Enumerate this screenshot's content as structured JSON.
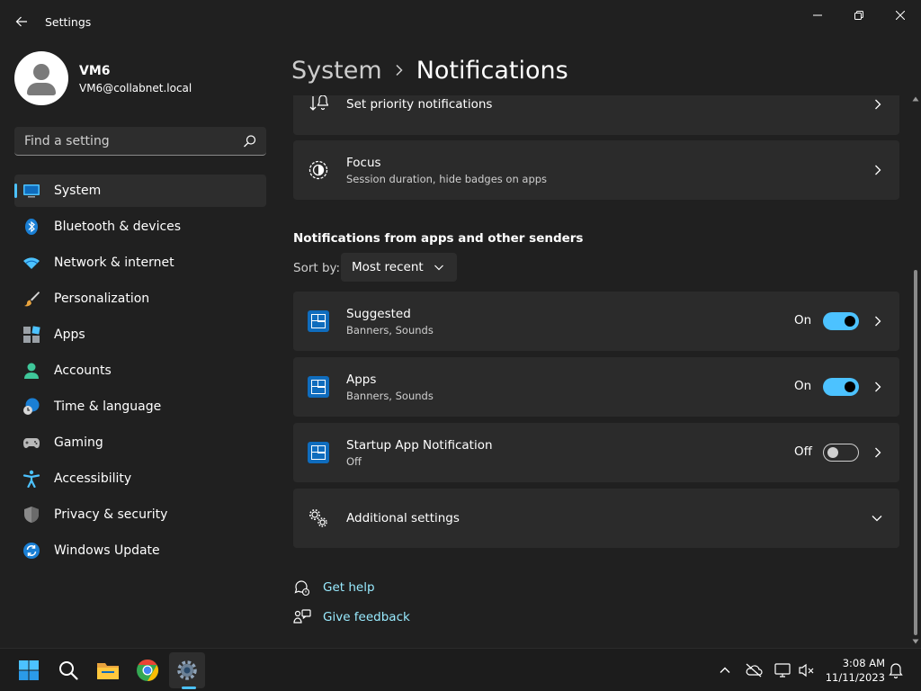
{
  "window": {
    "title": "Settings"
  },
  "profile": {
    "name": "VM6",
    "email": "VM6@collabnet.local"
  },
  "search": {
    "placeholder": "Find a setting"
  },
  "sidebar": {
    "items": [
      {
        "label": "System",
        "icon": "system-icon",
        "active": true
      },
      {
        "label": "Bluetooth & devices",
        "icon": "bluetooth-icon"
      },
      {
        "label": "Network & internet",
        "icon": "wifi-icon"
      },
      {
        "label": "Personalization",
        "icon": "brush-icon"
      },
      {
        "label": "Apps",
        "icon": "apps-icon"
      },
      {
        "label": "Accounts",
        "icon": "accounts-icon"
      },
      {
        "label": "Time & language",
        "icon": "clock-globe-icon"
      },
      {
        "label": "Gaming",
        "icon": "gamepad-icon"
      },
      {
        "label": "Accessibility",
        "icon": "accessibility-icon"
      },
      {
        "label": "Privacy & security",
        "icon": "shield-icon"
      },
      {
        "label": "Windows Update",
        "icon": "update-icon"
      }
    ]
  },
  "header": {
    "parent": "System",
    "current": "Notifications"
  },
  "cards": {
    "priority": {
      "title": "Set priority notifications"
    },
    "focus": {
      "title": "Focus",
      "subtitle": "Session duration, hide badges on apps"
    }
  },
  "senders": {
    "section_title": "Notifications from apps and other senders",
    "sort_label": "Sort by:",
    "sort_value": "Most recent",
    "items": [
      {
        "title": "Suggested",
        "subtitle": "Banners, Sounds",
        "state": "On",
        "enabled": true
      },
      {
        "title": "Apps",
        "subtitle": "Banners, Sounds",
        "state": "On",
        "enabled": true
      },
      {
        "title": "Startup App Notification",
        "subtitle": "Off",
        "state": "Off",
        "enabled": false
      }
    ]
  },
  "additional": {
    "title": "Additional settings"
  },
  "help": {
    "get_help": "Get help",
    "give_feedback": "Give feedback"
  },
  "taskbar": {
    "time": "3:08 AM",
    "date": "11/11/2023"
  },
  "colors": {
    "accent": "#4cc2ff",
    "link": "#99ebff",
    "card": "#2b2b2b",
    "background": "#202020"
  }
}
